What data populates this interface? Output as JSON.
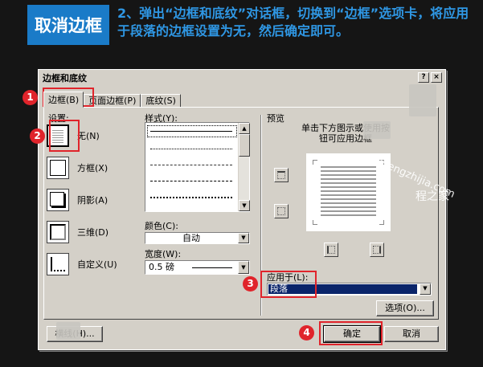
{
  "banner": {
    "title": "取消边框",
    "instruction": "2、弹出“边框和底纹”对话框，切换到“边框”选项卡，将应用于段落的边框设置为无，然后确定即可。"
  },
  "dialog": {
    "title": "边框和底纹",
    "help_button": "?",
    "close_button": "×",
    "tabs": [
      "边框(B)",
      "页面边框(P)",
      "底纹(S)"
    ],
    "setting_label": "设置:",
    "settings": [
      "无(N)",
      "方框(X)",
      "阴影(A)",
      "三维(D)",
      "自定义(U)"
    ],
    "style_label": "样式(Y):",
    "color_label": "颜色(C):",
    "color_value": "自动",
    "width_label": "宽度(W):",
    "width_value": "0.5 磅",
    "preview_label": "预览",
    "preview_hint": "单击下方图示或使用按钮可应用边框",
    "apply_to_label": "应用于(L):",
    "apply_to_value": "段落",
    "options_button": "选项(O)...",
    "bottom_left_button": "横线(H)...",
    "ok_button": "确定",
    "cancel_button": "取消"
  },
  "callouts": [
    "1",
    "2",
    "3",
    "4"
  ],
  "watermark": {
    "line1": "chengzhijia.com",
    "line2": "程之家"
  },
  "colors": {
    "accent": "#e0242b",
    "banner_bg": "#1a7bc8",
    "banner_text": "#2f97e4",
    "selection": "#0a246a"
  }
}
